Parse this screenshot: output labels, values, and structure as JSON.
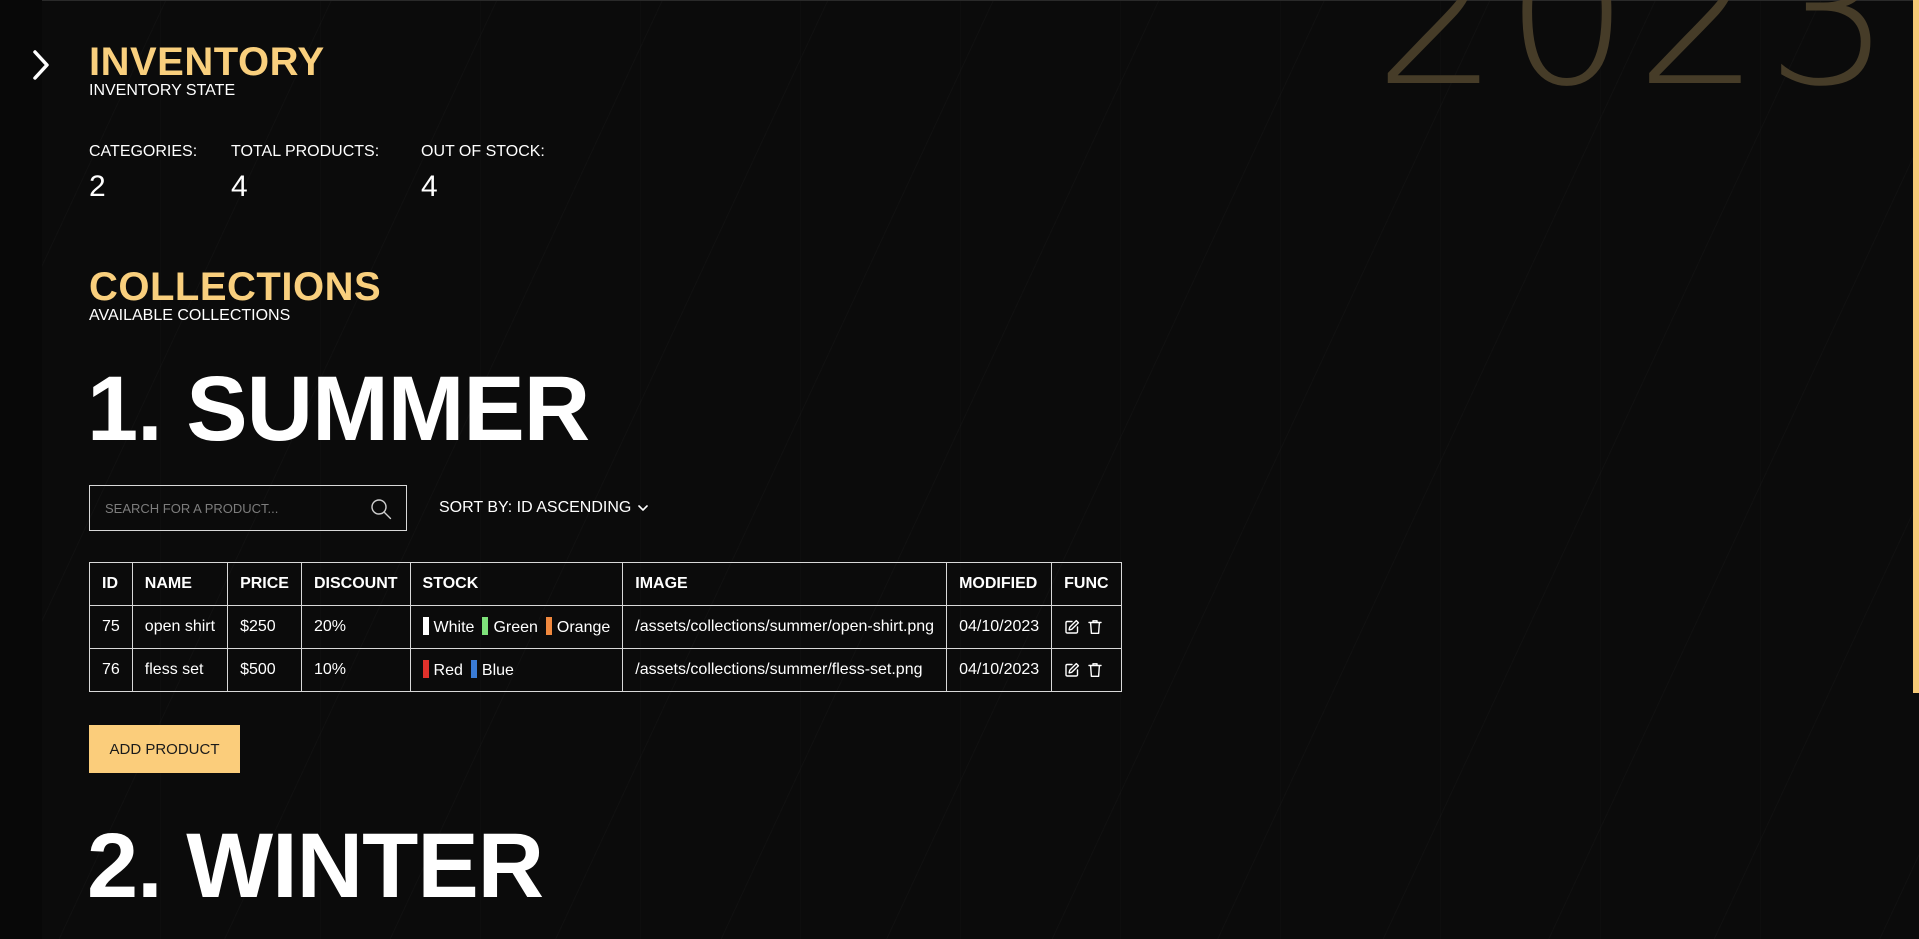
{
  "background_watermark": "2023",
  "inventory": {
    "title": "INVENTORY",
    "subtitle": "INVENTORY STATE",
    "stats": [
      {
        "label": "CATEGORIES:",
        "value": "2"
      },
      {
        "label": "TOTAL PRODUCTS:",
        "value": "4"
      },
      {
        "label": "OUT OF STOCK:",
        "value": "4"
      }
    ]
  },
  "collections": {
    "title": "COLLECTIONS",
    "subtitle": "AVAILABLE COLLECTIONS",
    "items": [
      {
        "heading": "1. SUMMER",
        "search_placeholder": "SEARCH FOR A PRODUCT...",
        "sort_label": "SORT BY: ID ASCENDING",
        "columns": [
          "ID",
          "NAME",
          "PRICE",
          "DISCOUNT",
          "STOCK",
          "IMAGE",
          "MODIFIED",
          "FUNC"
        ],
        "rows": [
          {
            "id": "75",
            "name": "open shirt",
            "price": "$250",
            "discount": "20%",
            "stock": [
              {
                "name": "White",
                "color": "#ffffff"
              },
              {
                "name": "Green",
                "color": "#7ee27a"
              },
              {
                "name": "Orange",
                "color": "#f0883e"
              }
            ],
            "image": "/assets/collections/summer/open-shirt.png",
            "modified": "04/10/2023"
          },
          {
            "id": "76",
            "name": "fless set",
            "price": "$500",
            "discount": "10%",
            "stock": [
              {
                "name": "Red",
                "color": "#e0312b"
              },
              {
                "name": "Blue",
                "color": "#3a7bd5"
              }
            ],
            "image": "/assets/collections/summer/fless-set.png",
            "modified": "04/10/2023"
          }
        ],
        "add_button": "ADD PRODUCT"
      },
      {
        "heading": "2. WINTER"
      }
    ]
  },
  "colors": {
    "accent": "#f9cf7d",
    "background": "#0b0b0b",
    "button_bg": "#fbcd7b"
  },
  "icons": {
    "sidebar_toggle": "chevron-right-icon",
    "search": "search-icon",
    "sort": "chevron-down-icon",
    "edit": "edit-icon",
    "delete": "trash-icon"
  }
}
